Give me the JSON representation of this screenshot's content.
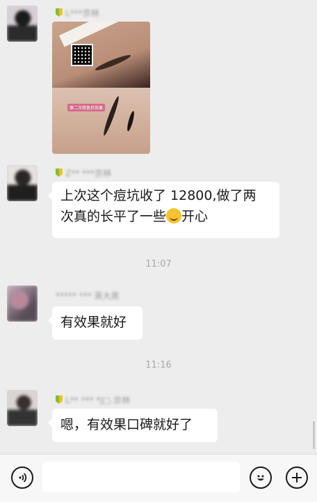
{
  "messages": [
    {
      "sender": "L***京林",
      "type": "image"
    },
    {
      "sender": "Z** ***京林",
      "text_line1": "上次这个痘坑收了 12800,做了两",
      "text_line2_pre": "次真的长平了一些",
      "text_line2_post": "开心",
      "emoji": "hugging-face"
    },
    {
      "time": "11:07"
    },
    {
      "sender": "***** *** 英大奥",
      "text": "有效果就好"
    },
    {
      "time": "11:16"
    },
    {
      "sender": "L** *** *J□.京林",
      "text": "嗯，有效果口碑就好了"
    }
  ],
  "photo": {
    "label": "第二次修复后效果"
  },
  "input": {
    "value": "",
    "placeholder": ""
  },
  "icons": {
    "voice": "voice-icon",
    "emoji": "emoji-icon",
    "more": "plus-icon"
  }
}
